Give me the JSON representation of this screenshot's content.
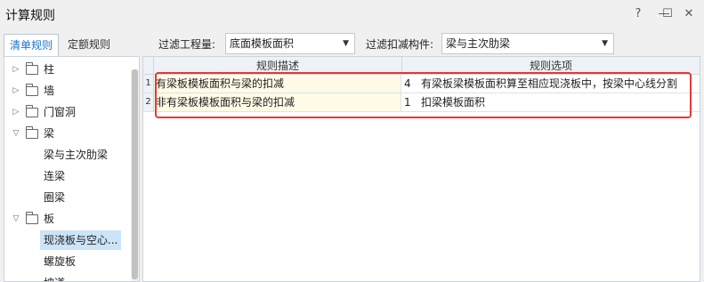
{
  "window": {
    "title": "计算规则",
    "help_glyph": "?",
    "minimize_glyph": "—",
    "maximize_glyph": "☐",
    "close_glyph": "✕"
  },
  "tabs": [
    {
      "label": "清单规则",
      "active": true
    },
    {
      "label": "定额规则",
      "active": false
    }
  ],
  "filters": {
    "quantity_label": "过滤工程量:",
    "quantity_value": "底面模板面积",
    "component_label": "过滤扣减构件:",
    "component_value": "梁与主次肋梁"
  },
  "tree": {
    "items": [
      {
        "label": "柱",
        "expand": "▷"
      },
      {
        "label": "墙",
        "expand": "▷"
      },
      {
        "label": "门窗洞",
        "expand": "▷"
      },
      {
        "label": "梁",
        "expand": "▽"
      },
      {
        "label": "板",
        "expand": "▽"
      }
    ],
    "beam_children": [
      "梁与主次肋梁",
      "连梁",
      "圈梁"
    ],
    "slab_children": [
      "现浇板与空心...",
      "螺旋板",
      "坡道"
    ],
    "selected": "现浇板与空心..."
  },
  "grid": {
    "headers": [
      "规则描述",
      "规则选项"
    ],
    "rows": [
      {
        "num": "1",
        "desc": "有梁板模板面积与梁的扣减",
        "opt_num": "4",
        "opt": "有梁板梁模板面积算至相应现浇板中，按梁中心线分割"
      },
      {
        "num": "2",
        "desc": "非有梁板模板面积与梁的扣减",
        "opt_num": "1",
        "opt": "扣梁模板面积"
      }
    ]
  },
  "colors": {
    "accent": "#1a73c8",
    "highlight_border": "#e53935",
    "row_desc_bg": "#fffbe6",
    "selected_bg": "#cce4f7"
  }
}
